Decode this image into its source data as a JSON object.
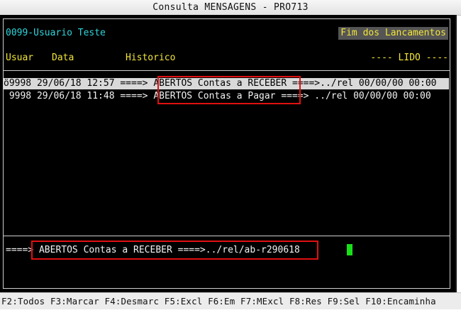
{
  "window": {
    "title": "Consulta MENSAGENS - PRO713"
  },
  "header": {
    "user": "0099-Usuario Teste",
    "status": "Fim dos Lancamentos"
  },
  "columns": {
    "usuar": "Usuar",
    "data": "Data",
    "historico": "Historico",
    "lido": "---- LIDO ----"
  },
  "rows": [
    {
      "text": "ö9998 29/06/18 12:57 ====> ABERTOS Contas a RECEBER ====>../rel 00/00/00 00:00",
      "selected": true
    },
    {
      "text": " 9998 29/06/18 11:48 ====> ABERTOS Contas a Pagar ====> ../rel 00/00/00 00:00",
      "selected": false
    }
  ],
  "detail": {
    "text": "====> ABERTOS Contas a RECEBER ====>../rel/ab-r290618"
  },
  "function_keys": {
    "line": "F2:Todos F3:Marcar F4:Desmarc F5:Excl F6:Em F7:MExcl F8:Res F9:Sel F10:Encaminha"
  },
  "colors": {
    "terminal_bg": "#000000",
    "cyan": "#2fd6dc",
    "yellow": "#f2e53a",
    "highlight_red": "#e01010",
    "cursor_green": "#18e018"
  }
}
